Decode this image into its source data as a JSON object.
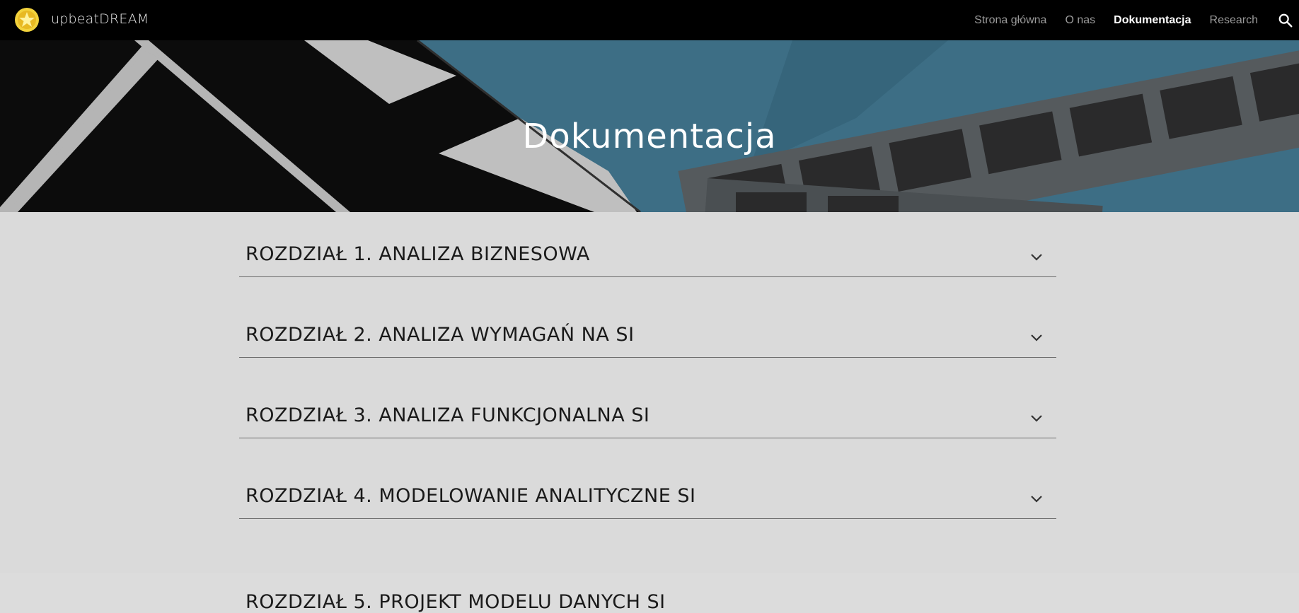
{
  "header": {
    "site_name": "upbeatDREAM",
    "logo_icon": "star-coin-icon",
    "nav": [
      {
        "label": "Strona główna",
        "active": false
      },
      {
        "label": "O nas",
        "active": false
      },
      {
        "label": "Dokumentacja",
        "active": true
      },
      {
        "label": "Research",
        "active": false
      }
    ],
    "search_icon": "search-icon"
  },
  "hero": {
    "title": "Dokumentacja"
  },
  "sections": [
    {
      "title": "ROZDZIAŁ 1. ANALIZA BIZNESOWA"
    },
    {
      "title": "ROZDZIAŁ 2. ANALIZA WYMAGAŃ NA SI"
    },
    {
      "title": "ROZDZIAŁ 3. ANALIZA FUNKCJONALNA SI"
    },
    {
      "title": "ROZDZIAŁ 4. MODELOWANIE ANALITYCZNE SI"
    },
    {
      "title": "ROZDZIAŁ 5. PROJEKT MODELU DANYCH SI"
    }
  ],
  "colors": {
    "nav_bg": "#000000",
    "hero_teal": "#3d6e85",
    "content_bg": "#dadada",
    "logo_yellow": "#f2d23c"
  }
}
